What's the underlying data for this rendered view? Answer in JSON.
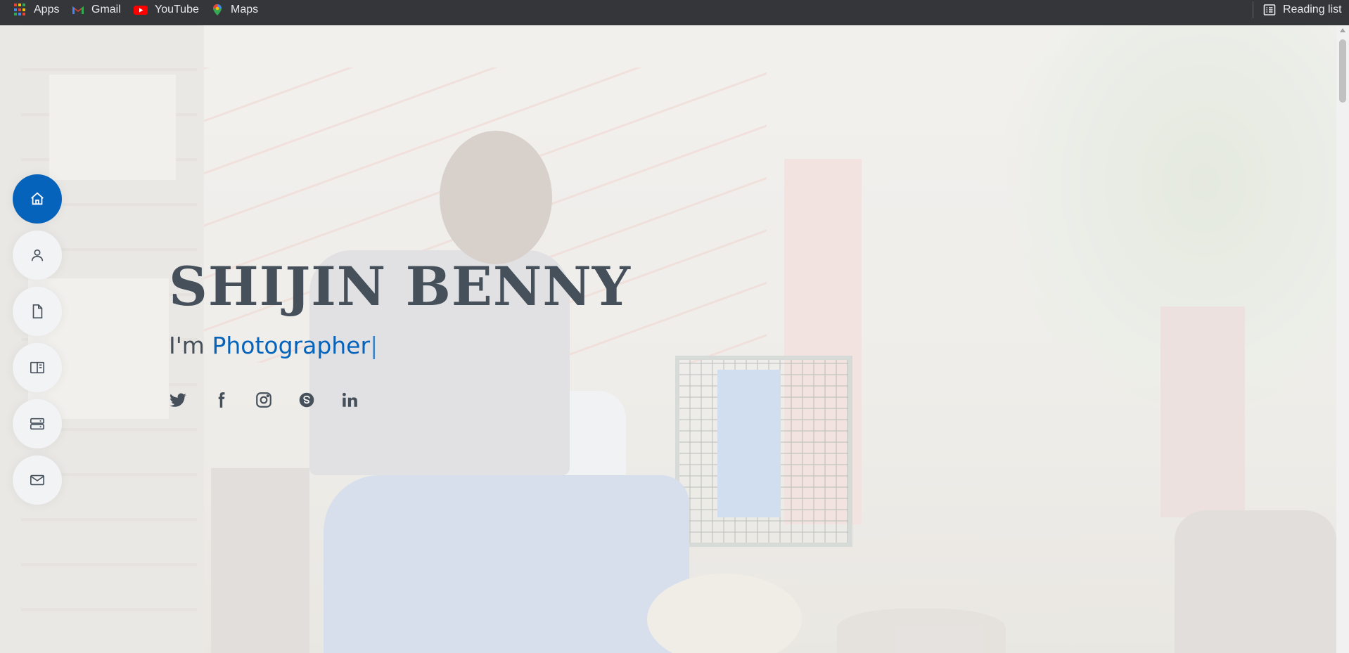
{
  "bookmarks": {
    "items": [
      {
        "label": "Apps",
        "icon": "apps-grid-icon"
      },
      {
        "label": "Gmail",
        "icon": "gmail-icon"
      },
      {
        "label": "YouTube",
        "icon": "youtube-icon"
      },
      {
        "label": "Maps",
        "icon": "maps-icon"
      }
    ],
    "reading_list": {
      "label": "Reading list",
      "icon": "reading-list-icon"
    }
  },
  "side_nav": {
    "items": [
      {
        "name": "home",
        "icon": "home-icon",
        "active": true
      },
      {
        "name": "about",
        "icon": "person-icon",
        "active": false
      },
      {
        "name": "resume",
        "icon": "file-icon",
        "active": false
      },
      {
        "name": "portfolio",
        "icon": "book-icon",
        "active": false
      },
      {
        "name": "services",
        "icon": "server-icon",
        "active": false
      },
      {
        "name": "contact",
        "icon": "envelope-icon",
        "active": false
      }
    ]
  },
  "hero": {
    "name": "SHIJIN BENNY",
    "subtitle_prefix": "I'm",
    "typed_text": "Photographer",
    "cursor": "|",
    "social": [
      "twitter-icon",
      "facebook-icon",
      "instagram-icon",
      "skype-icon",
      "linkedin-icon"
    ]
  },
  "colors": {
    "accent": "#0563bb",
    "heading": "#45505b",
    "bookmarks_bg": "#35363a"
  }
}
